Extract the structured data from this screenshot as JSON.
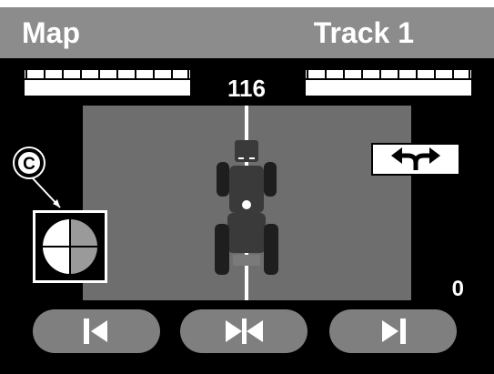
{
  "header": {
    "title_left": "Map",
    "title_right": "Track 1"
  },
  "guidance": {
    "heading_value": "116",
    "offset_value": "0"
  },
  "callout": {
    "letter": "C"
  },
  "icons": {
    "swap_direction": "swap-direction-icon",
    "compass": "compass-icon",
    "shift_left": "shift-left-icon",
    "center": "center-icon",
    "shift_right": "shift-right-icon"
  },
  "colors": {
    "titlebar": "#8c8c8c",
    "field": "#6e6e6e",
    "buttons": "#7f7f7f",
    "tractor": "#3a3a3a"
  }
}
